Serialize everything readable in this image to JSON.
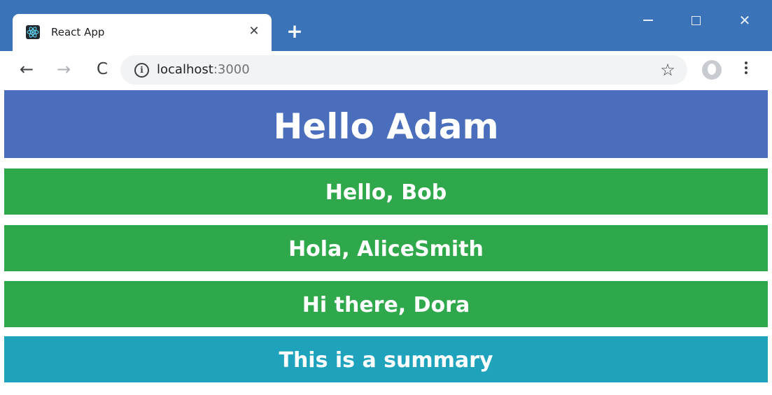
{
  "browser": {
    "tab": {
      "title": "React App",
      "favicon": "react-logo-icon",
      "close_glyph": "✕"
    },
    "new_tab_glyph": "+",
    "window_controls": {
      "minimize": "minimize-icon",
      "maximize": "maximize-icon",
      "close_glyph": "✕"
    },
    "toolbar": {
      "back_glyph": "←",
      "forward_glyph": "→",
      "reload_glyph": "C",
      "url_host": "localhost",
      "url_port": ":3000",
      "info_glyph": "i",
      "star_glyph": "☆"
    },
    "colors": {
      "titlebar": "#3b73b9"
    }
  },
  "page": {
    "header": {
      "text": "Hello Adam",
      "color": "#4a6ebb"
    },
    "messages": [
      {
        "text": "Hello, Bob",
        "color": "#2ea84a"
      },
      {
        "text": "Hola, AliceSmith",
        "color": "#2ea84a"
      },
      {
        "text": "Hi there, Dora",
        "color": "#2ea84a"
      }
    ],
    "summary": {
      "text": "This is a summary",
      "color": "#1fa3bd"
    }
  }
}
